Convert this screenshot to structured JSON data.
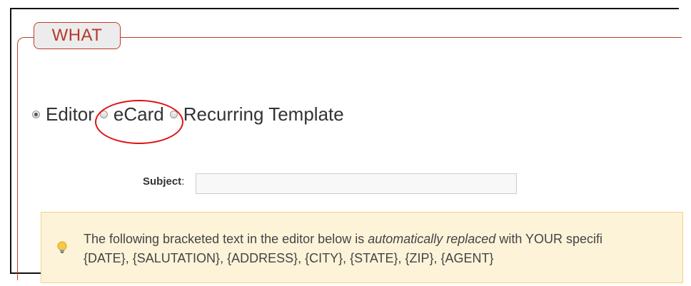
{
  "section": {
    "legend": "WHAT"
  },
  "mode_options": [
    {
      "label": "Editor",
      "checked": true
    },
    {
      "label": "eCard",
      "checked": false
    },
    {
      "label": "Recurring Template",
      "checked": false
    }
  ],
  "subject": {
    "label": "Subject",
    "colon": ":",
    "value": ""
  },
  "notice": {
    "line1_before": "The following bracketed text in the editor below is ",
    "line1_emph": "automatically replaced",
    "line1_after": " with YOUR specifi",
    "line2": "{DATE}, {SALUTATION}, {ADDRESS}, {CITY}, {STATE}, {ZIP}, {AGENT}"
  },
  "colors": {
    "accent": "#c0392b",
    "notice_bg": "#fdf3d9",
    "annotation": "#e01010"
  }
}
